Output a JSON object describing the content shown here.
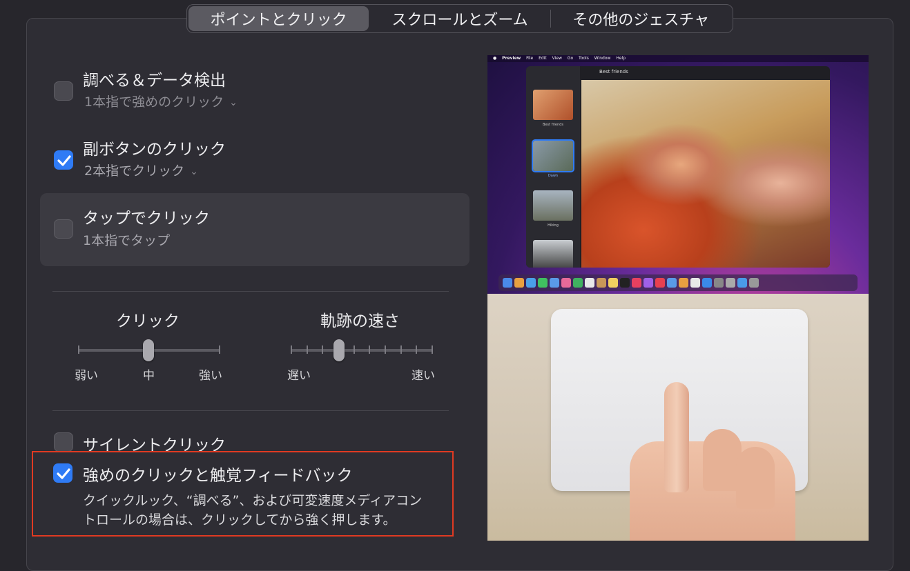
{
  "tabs": [
    {
      "label": "ポイントとクリック",
      "selected": true
    },
    {
      "label": "スクロールとズーム",
      "selected": false
    },
    {
      "label": "その他のジェスチャ",
      "selected": false
    }
  ],
  "options": {
    "lookup": {
      "label": "調べる＆データ検出",
      "sub": "1本指で強めのクリック",
      "checked": false
    },
    "secondary": {
      "label": "副ボタンのクリック",
      "sub": "2本指でクリック",
      "checked": true
    },
    "tap": {
      "label": "タップでクリック",
      "sub": "1本指でタップ",
      "checked": false
    }
  },
  "sliders": {
    "click": {
      "title": "クリック",
      "min_label": "弱い",
      "mid_label": "中",
      "max_label": "強い",
      "value": 0.5,
      "steps": 3
    },
    "tracking": {
      "title": "軌跡の速さ",
      "min_label": "遅い",
      "max_label": "速い",
      "value": 0.3,
      "steps": 10
    }
  },
  "silent_click": {
    "label": "サイレントクリック",
    "checked": false
  },
  "force_click": {
    "label": "強めのクリックと触覚フィードバック",
    "checked": true,
    "desc_line1": "クイックルック、“調べる”、および可変速度メディアコン",
    "desc_line2": "トロールの場合は、クリックしてから強く押します。"
  },
  "preview": {
    "menubar": [
      "Preview",
      "File",
      "Edit",
      "View",
      "Go",
      "Tools",
      "Window",
      "Help"
    ],
    "window_title": "Best friends",
    "thumb_labels": [
      "Best friends",
      "Dawn",
      "Hiking"
    ]
  },
  "colors": {
    "accent": "#2f7bf5",
    "highlight_border": "#e03a22"
  }
}
